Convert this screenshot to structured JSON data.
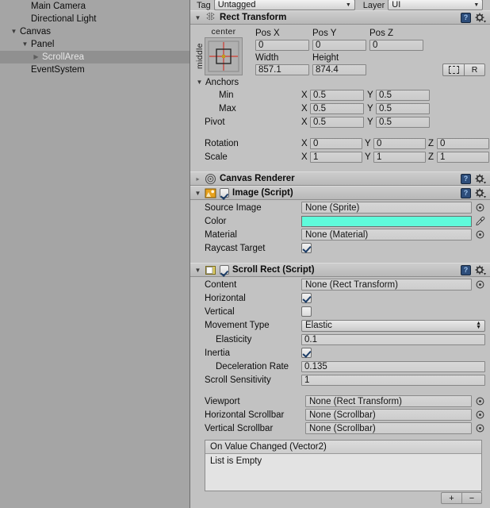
{
  "hierarchy": {
    "items": [
      {
        "label": "Main Camera",
        "depth": 1,
        "arrow": "",
        "selected": false
      },
      {
        "label": "Directional Light",
        "depth": 1,
        "arrow": "",
        "selected": false
      },
      {
        "label": "Canvas",
        "depth": 0,
        "arrow": "▼",
        "selected": false
      },
      {
        "label": "Panel",
        "depth": 1,
        "arrow": "▼",
        "selected": false
      },
      {
        "label": "ScrollArea",
        "depth": 2,
        "arrow": "▶",
        "selected": true
      },
      {
        "label": "EventSystem",
        "depth": 1,
        "arrow": "",
        "selected": false
      }
    ]
  },
  "inspector": {
    "tag_label": "Tag",
    "tag_value": "Untagged",
    "layer_label": "Layer",
    "layer_value": "UI",
    "rect_transform": {
      "title": "Rect Transform",
      "anchor_preset_h": "center",
      "anchor_preset_v": "middle",
      "headers": [
        "Pos X",
        "Pos Y",
        "Pos Z"
      ],
      "pos": [
        "0",
        "0",
        "0"
      ],
      "size_headers": [
        "Width",
        "Height"
      ],
      "size": [
        "857.1",
        "874.4"
      ],
      "blueprint_label": "",
      "raw_label": "R",
      "anchors_label": "Anchors",
      "min_label": "Min",
      "min": {
        "x": "0.5",
        "y": "0.5"
      },
      "max_label": "Max",
      "max": {
        "x": "0.5",
        "y": "0.5"
      },
      "pivot_label": "Pivot",
      "pivot": {
        "x": "0.5",
        "y": "0.5"
      },
      "rotation_label": "Rotation",
      "rotation": {
        "x": "0",
        "y": "0",
        "z": "0"
      },
      "scale_label": "Scale",
      "scale": {
        "x": "1",
        "y": "1",
        "z": "1"
      },
      "axis_x": "X",
      "axis_y": "Y",
      "axis_z": "Z"
    },
    "canvas_renderer": {
      "title": "Canvas Renderer"
    },
    "image": {
      "title": "Image (Script)",
      "enabled": true,
      "source_image_label": "Source Image",
      "source_image_value": "None (Sprite)",
      "color_label": "Color",
      "color_value": "#5FFBDB",
      "material_label": "Material",
      "material_value": "None (Material)",
      "raycast_label": "Raycast Target",
      "raycast_checked": true
    },
    "scroll_rect": {
      "title": "Scroll Rect (Script)",
      "enabled": true,
      "content_label": "Content",
      "content_value": "None (Rect Transform)",
      "horizontal_label": "Horizontal",
      "horizontal_checked": true,
      "vertical_label": "Vertical",
      "vertical_checked": false,
      "movement_type_label": "Movement Type",
      "movement_type_value": "Elastic",
      "elasticity_label": "Elasticity",
      "elasticity_value": "0.1",
      "inertia_label": "Inertia",
      "inertia_checked": true,
      "deceleration_label": "Deceleration Rate",
      "deceleration_value": "0.135",
      "sensitivity_label": "Scroll Sensitivity",
      "sensitivity_value": "1",
      "viewport_label": "Viewport",
      "viewport_value": "None (Rect Transform)",
      "hscrollbar_label": "Horizontal Scrollbar",
      "hscrollbar_value": "None (Scrollbar)",
      "vscrollbar_label": "Vertical Scrollbar",
      "vscrollbar_value": "None (Scrollbar)",
      "event_title": "On Value Changed (Vector2)",
      "event_empty": "List is Empty",
      "add_label": "+",
      "remove_label": "−"
    }
  }
}
